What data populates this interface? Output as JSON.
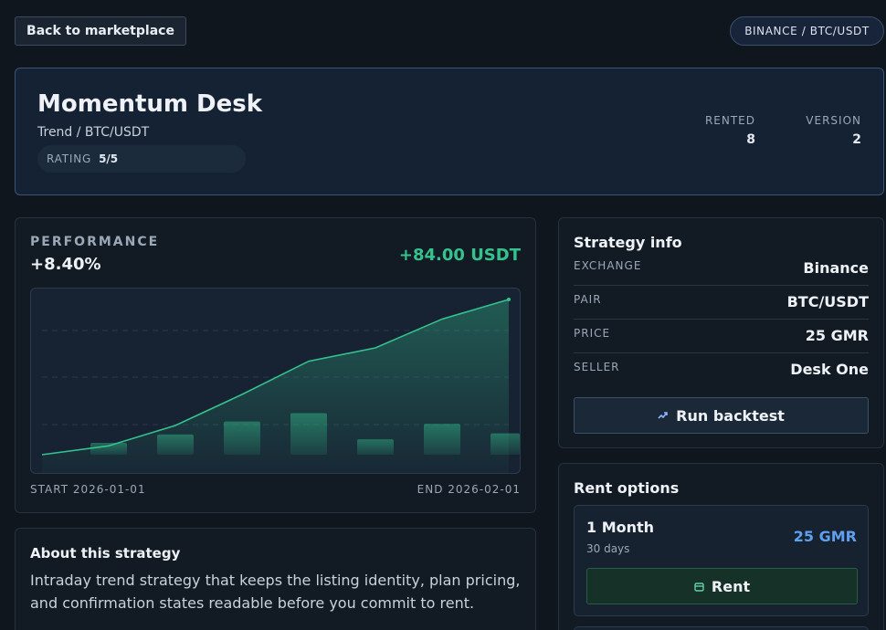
{
  "nav": {
    "back_label": "Back to marketplace",
    "pair_badge": "BINANCE / BTC/USDT"
  },
  "hero": {
    "title": "Momentum Desk",
    "subtitle": "Trend / BTC/USDT",
    "rating_label": "RATING",
    "rating_value": "5/5",
    "rented_label": "RENTED",
    "rented_value": "8",
    "version_label": "VERSION",
    "version_value": "2"
  },
  "performance": {
    "label": "PERFORMANCE",
    "percent": "+8.40%",
    "profit": "+84.00 USDT",
    "start": "START 2026-01-01",
    "end": "END 2026-02-01",
    "accent_color": "#34c28e"
  },
  "chart_data": {
    "type": "area",
    "line": [
      0.0,
      0.48,
      1.58,
      3.26,
      5.06,
      5.78,
      7.34,
      8.4
    ],
    "bars": [
      0.5,
      0.85,
      1.4,
      1.75,
      0.65,
      1.3,
      0.9
    ]
  },
  "about": {
    "title": "About this strategy",
    "text": "Intraday trend strategy that keeps the listing identity, plan pricing, and confirmation states readable before you commit to rent."
  },
  "info": {
    "title": "Strategy info",
    "rows": [
      {
        "key": "EXCHANGE",
        "value": "Binance"
      },
      {
        "key": "PAIR",
        "value": "BTC/USDT"
      },
      {
        "key": "PRICE",
        "value": "25 GMR"
      },
      {
        "key": "SELLER",
        "value": "Desk One"
      }
    ],
    "backtest_label": "Run backtest",
    "backtest_icon": "trend-icon"
  },
  "rent": {
    "title": "Rent options",
    "options": [
      {
        "name": "1 Month",
        "days": "30 days",
        "price": "25 GMR",
        "button": "Rent",
        "icon": "box-icon"
      }
    ]
  }
}
